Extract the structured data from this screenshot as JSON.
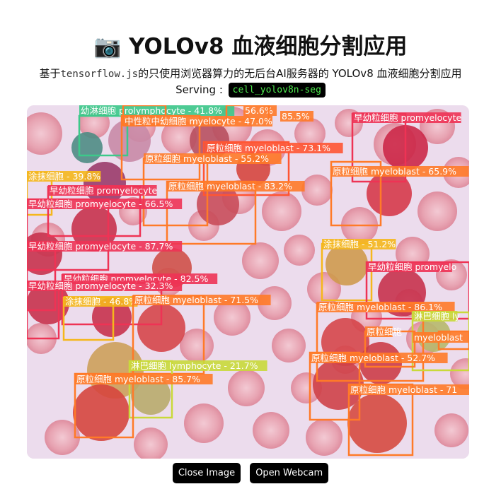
{
  "header": {
    "icon": "camera-icon",
    "icon_glyph": "📷",
    "title": "YOLOv8 血液细胞分割应用"
  },
  "subtitle": {
    "prefix": "基于",
    "lib": "tensorflow.js",
    "suffix": "的只使用浏览器算力的无后台AI服务器的 YOLOv8 血液细胞分割应用"
  },
  "serving": {
    "label": "Serving :",
    "model": "cell_yolov8n-seg"
  },
  "detections": [
    {
      "label": "幼淋细胞 prolymphocyte - 41.8%",
      "color": "#3cc98a"
    },
    {
      "label": "56.6%",
      "color": "#ff7a28"
    },
    {
      "label": "85.5%",
      "color": "#ff7a28"
    },
    {
      "label": "中性粒中幼细胞 myelocyte - 47.0%",
      "color": "#ff7a28"
    },
    {
      "label": "早幼粒细胞 promyelocyte",
      "color": "#ee3355"
    },
    {
      "label": "原粒细胞 myeloblast - 73.1%",
      "color": "#ff5533"
    },
    {
      "label": "原粒细胞 myeloblast - 55.2%",
      "color": "#ff7a28"
    },
    {
      "label": "原粒细胞 myeloblast - 65.9%",
      "color": "#ff7a28"
    },
    {
      "label": "涂抹细胞 - 39.8%",
      "color": "#f5b71c"
    },
    {
      "label": "早幼粒细胞 promyelocyte",
      "color": "#ee3355"
    },
    {
      "label": "原粒细胞 myeloblast - 83.2%",
      "color": "#ff7a28"
    },
    {
      "label": "早幼粒细胞 promyelocyte - 66.5%",
      "color": "#ee3355"
    },
    {
      "label": "早幼粒细胞 promyelocyte - 87.7%",
      "color": "#ee3355"
    },
    {
      "label": "涂抹细胞 - 51.2%",
      "color": "#f5b71c"
    },
    {
      "label": "早幼粒细胞 promyelo",
      "color": "#ee3355"
    },
    {
      "label": "早幼粒细胞 promyelocyte - 82.5%",
      "color": "#ee3355"
    },
    {
      "label": "早幼粒细胞 promyelocyte - 32.3%",
      "color": "#ee3355"
    },
    {
      "label": "涂抹细胞 - 46.8%",
      "color": "#f5b71c"
    },
    {
      "label": "原粒细胞 myeloblast - 71.5%",
      "color": "#ff7a28"
    },
    {
      "label": "原粒细胞 myeloblast - 86.1%",
      "color": "#ff7a28"
    },
    {
      "label": "淋巴细胞 ly",
      "color": "#c9d93a"
    },
    {
      "label": "原粒细胞",
      "color": "#ff7a28"
    },
    {
      "label": "myeloblast",
      "color": "#ff7a28"
    },
    {
      "label": "原粒细胞 myeloblast - 52.7%",
      "color": "#ff7a28"
    },
    {
      "label": "淋巴细胞 lymphocyte - 21.7%",
      "color": "#c9d93a"
    },
    {
      "label": "原粒细胞 myeloblast - 85.7%",
      "color": "#ff7a28"
    },
    {
      "label": "原粒细胞 myeloblast - 71",
      "color": "#ff7a28"
    }
  ],
  "buttons": {
    "close_image": "Close Image",
    "open_webcam": "Open Webcam"
  }
}
